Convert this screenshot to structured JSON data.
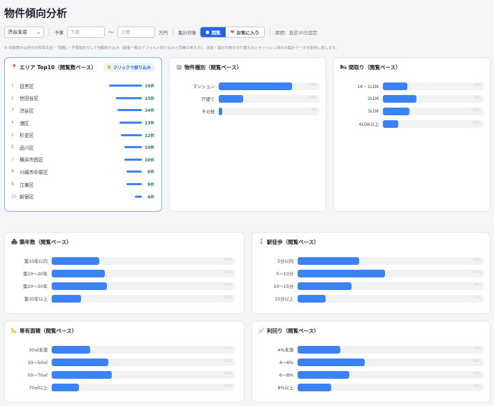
{
  "page_title": "物件傾向分析",
  "filters": {
    "branch": "渋谷支店",
    "budget_label": "予算",
    "budget_min_placeholder": "下限",
    "budget_max_placeholder": "上限",
    "tilde": "〜",
    "unit": "万円",
    "target_label": "集計対象",
    "seg_view": "閲覧",
    "seg_fav": "お気に入り",
    "period": "期間：直近30日固定"
  },
  "note": "※ 初期表示は自分の所属支店・「閲覧」・予算指定なしで自動絞り込み（顧客一覧のデフォルト絞り込みと同様の考え方）。支店・集計対象を切り替えるとキャッシュ済みの集計データを取得し直します。",
  "area": {
    "title": "エリア Top10（閲覧数ベース）",
    "badge": "クリックで絞り込み",
    "rows": [
      {
        "no": "1",
        "name": "目黒区",
        "count": "19件",
        "value": 19
      },
      {
        "no": "2",
        "name": "世田谷区",
        "count": "15件",
        "value": 15
      },
      {
        "no": "3",
        "name": "渋谷区",
        "count": "14件",
        "value": 14
      },
      {
        "no": "4",
        "name": "港区",
        "count": "13件",
        "value": 13
      },
      {
        "no": "5",
        "name": "杉並区",
        "count": "12件",
        "value": 12
      },
      {
        "no": "6",
        "name": "品川区",
        "count": "10件",
        "value": 10
      },
      {
        "no": "7",
        "name": "横浜市西区",
        "count": "10件",
        "value": 10
      },
      {
        "no": "8",
        "name": "川崎市中原区",
        "count": "9件",
        "value": 9
      },
      {
        "no": "9",
        "name": "江東区",
        "count": "9件",
        "value": 9
      },
      {
        "no": "10",
        "name": "新宿区",
        "count": "4件",
        "value": 4
      }
    ]
  },
  "charts": [
    {
      "key": "type",
      "title": "物件種別（閲覧ベース）",
      "icon": "building-icon",
      "rows": [
        {
          "label": "マンション",
          "value": 0.73
        },
        {
          "label": "戸建て",
          "value": 0.24
        },
        {
          "label": "その他",
          "value": 0.03
        }
      ]
    },
    {
      "key": "layout",
      "title": "間取り（閲覧ベース）",
      "icon": "bed-icon",
      "rows": [
        {
          "label": "1K・1LDK",
          "value": 0.24
        },
        {
          "label": "2LDK",
          "value": 0.33
        },
        {
          "label": "3LDK",
          "value": 0.26
        },
        {
          "label": "4LDK以上",
          "value": 0.15
        }
      ]
    },
    {
      "key": "age",
      "title": "築年数（閲覧ベース）",
      "icon": "house-icon",
      "rows": [
        {
          "label": "築10年以内",
          "value": 0.26
        },
        {
          "label": "築10〜20年",
          "value": 0.29
        },
        {
          "label": "築20〜30年",
          "value": 0.3
        },
        {
          "label": "築30年以上",
          "value": 0.16
        }
      ]
    },
    {
      "key": "walk",
      "title": "駅徒歩（閲覧ベース）",
      "icon": "walk-icon",
      "rows": [
        {
          "label": "5分以内",
          "value": 0.33
        },
        {
          "label": "5〜10分",
          "value": 0.47
        },
        {
          "label": "10〜15分",
          "value": 0.29
        },
        {
          "label": "15分以上",
          "value": 0.15
        }
      ]
    },
    {
      "key": "area_size",
      "title": "専有面積（閲覧ベース）",
      "icon": "ruler-icon",
      "rows": [
        {
          "label": "30㎡未満",
          "value": 0.21
        },
        {
          "label": "30〜50㎡",
          "value": 0.31
        },
        {
          "label": "50〜70㎡",
          "value": 0.33
        },
        {
          "label": "70㎡以上",
          "value": 0.15
        }
      ]
    },
    {
      "key": "yield",
      "title": "利回り（閲覧ベース）",
      "icon": "chart-icon",
      "rows": [
        {
          "label": "4%未満",
          "value": 0.23
        },
        {
          "label": "4〜6%",
          "value": 0.36
        },
        {
          "label": "6〜8%",
          "value": 0.28
        },
        {
          "label": "8%以上",
          "value": 0.18
        }
      ]
    }
  ]
}
